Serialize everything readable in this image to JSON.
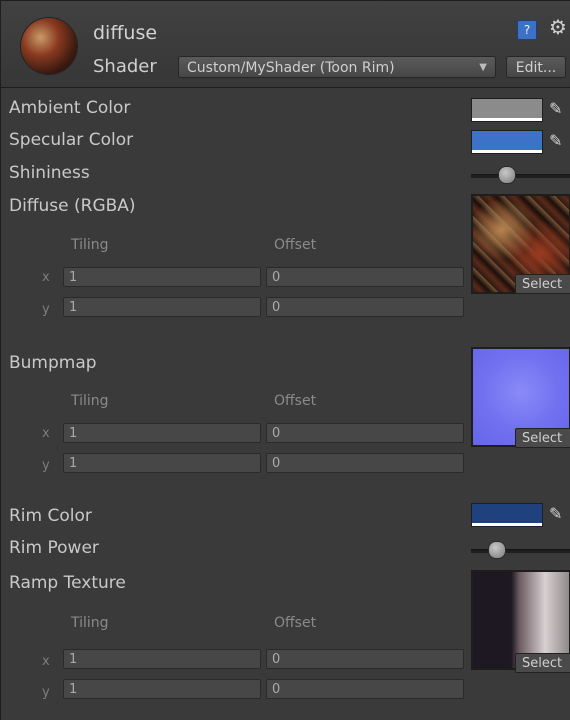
{
  "header": {
    "material_name": "diffuse",
    "shader_label": "Shader",
    "shader_value": "Custom/MyShader (Toon Rim)",
    "edit_label": "Edit...",
    "help_glyph": "?",
    "gear_glyph": "⚙"
  },
  "properties": {
    "ambient_color": {
      "label": "Ambient Color",
      "color": "#8b8b8b"
    },
    "specular_color": {
      "label": "Specular Color",
      "color": "#3c72c8"
    },
    "shininess": {
      "label": "Shininess",
      "value_fraction": 0.35
    },
    "diffuse_tex": {
      "label": "Diffuse (RGBA)",
      "tiling_label": "Tiling",
      "offset_label": "Offset",
      "x_label": "x",
      "y_label": "y",
      "tiling_x": "1",
      "tiling_y": "1",
      "offset_x": "0",
      "offset_y": "0",
      "select_label": "Select"
    },
    "bumpmap": {
      "label": "Bumpmap",
      "tiling_label": "Tiling",
      "offset_label": "Offset",
      "x_label": "x",
      "y_label": "y",
      "tiling_x": "1",
      "tiling_y": "1",
      "offset_x": "0",
      "offset_y": "0",
      "select_label": "Select"
    },
    "rim_color": {
      "label": "Rim Color",
      "color": "#1f427e"
    },
    "rim_power": {
      "label": "Rim Power",
      "value_fraction": 0.25
    },
    "ramp_texture": {
      "label": "Ramp Texture",
      "tiling_label": "Tiling",
      "offset_label": "Offset",
      "x_label": "x",
      "y_label": "y",
      "tiling_x": "1",
      "tiling_y": "1",
      "offset_x": "0",
      "offset_y": "0",
      "select_label": "Select"
    }
  },
  "icons": {
    "picker": "✎"
  }
}
